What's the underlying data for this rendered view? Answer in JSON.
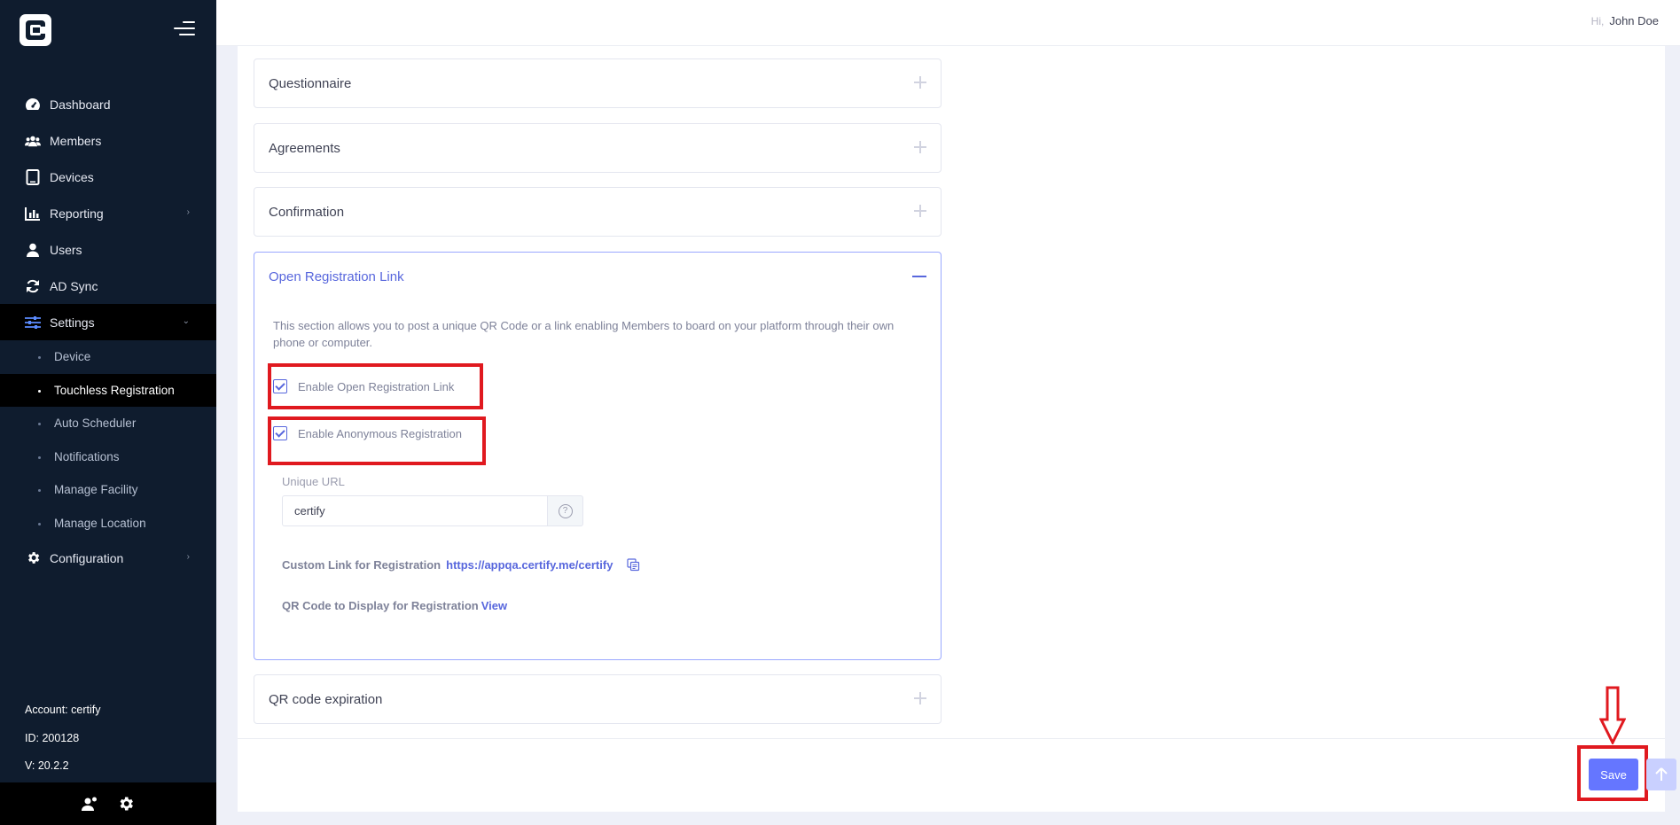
{
  "header": {
    "greeting_prefix": "Hi,",
    "user_name": "John Doe"
  },
  "sidebar": {
    "items": [
      {
        "label": "Dashboard",
        "icon": "dashboard-icon"
      },
      {
        "label": "Members",
        "icon": "members-icon"
      },
      {
        "label": "Devices",
        "icon": "tablet-icon"
      },
      {
        "label": "Reporting",
        "icon": "chart-icon"
      },
      {
        "label": "Users",
        "icon": "user-icon"
      },
      {
        "label": "AD Sync",
        "icon": "sync-icon"
      },
      {
        "label": "Settings",
        "icon": "sliders-icon"
      }
    ],
    "settings_sub": [
      "Device",
      "Touchless Registration",
      "Auto Scheduler",
      "Notifications",
      "Manage Facility",
      "Manage Location"
    ],
    "configuration": {
      "label": "Configuration",
      "icon": "gear-icon"
    },
    "account": "Account: certify",
    "id": "ID: 200128",
    "version": "V: 20.2.2"
  },
  "sections": {
    "questionnaire": "Questionnaire",
    "agreements": "Agreements",
    "confirmation": "Confirmation",
    "open_registration": "Open Registration Link",
    "qr_expiration": "QR code expiration"
  },
  "open_registration": {
    "description": "This section allows you to post a unique QR Code or a link enabling Members to board on your platform through their own phone or computer.",
    "enable_link_label": "Enable Open Registration Link",
    "enable_anonymous_label": "Enable Anonymous Registration",
    "unique_url_label": "Unique URL",
    "unique_url_value": "certify",
    "help_glyph": "?",
    "custom_link_label": "Custom Link for Registration",
    "custom_link_url": "https://appqa.certify.me/certify",
    "qr_label": "QR Code to Display for Registration",
    "qr_view": "View"
  },
  "footer": {
    "save_label": "Save"
  },
  "colors": {
    "sidebar_bg": "#0f1c2e",
    "accent": "#5867dd",
    "save_bg": "#6576ff",
    "annotation_red": "#e0191f"
  }
}
